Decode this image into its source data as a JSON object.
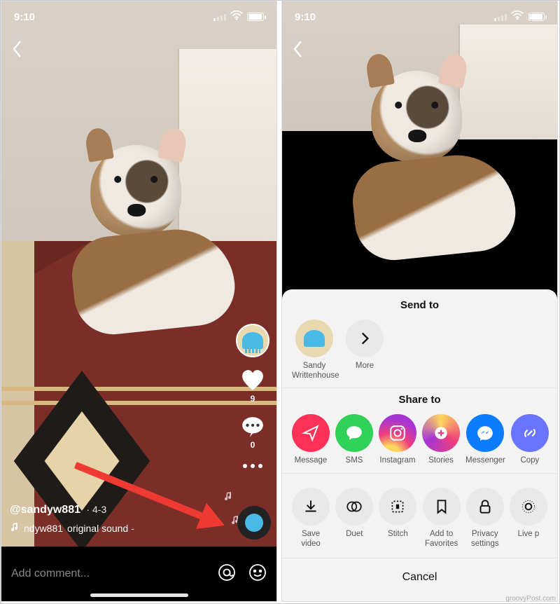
{
  "status": {
    "time": "9:10"
  },
  "left": {
    "likes": "9",
    "comments": "0",
    "username": "@sandyw881",
    "date": "4-3",
    "sound_prefix": "ndyw881",
    "sound_text": "original sound -",
    "comment_placeholder": "Add comment..."
  },
  "sheet": {
    "send_header": "Send to",
    "contact_name": "Sandy Writtenhouse",
    "more_label": "More",
    "share_header": "Share to",
    "share": {
      "message": "Message",
      "sms": "SMS",
      "instagram": "Instagram",
      "stories": "Stories",
      "messenger": "Messenger",
      "copy": "Copy"
    },
    "actions": {
      "save": "Save video",
      "duet": "Duet",
      "stitch": "Stitch",
      "favorites": "Add to Favorites",
      "privacy": "Privacy settings",
      "live": "Live p"
    },
    "cancel": "Cancel"
  },
  "watermark": "groovyPost.com"
}
